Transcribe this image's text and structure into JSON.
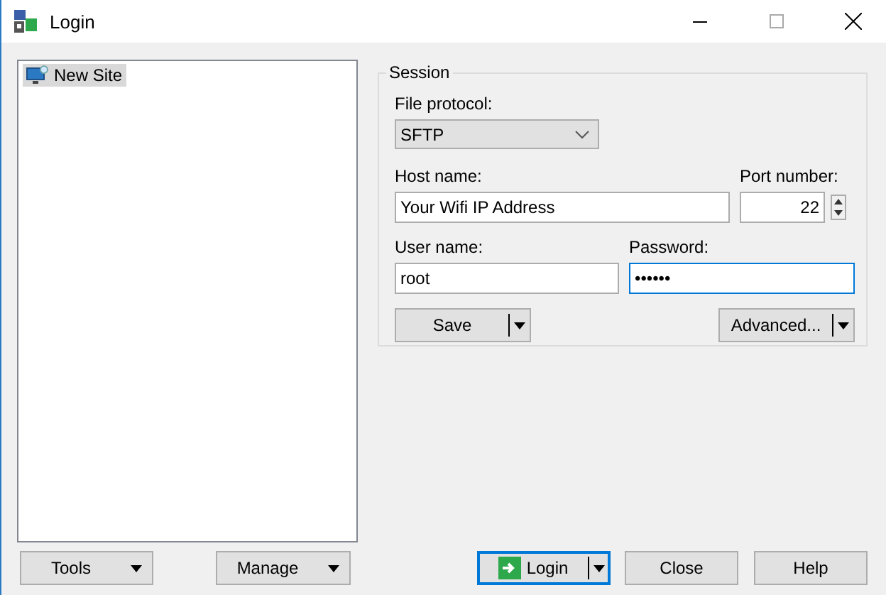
{
  "window": {
    "title": "Login"
  },
  "sites": [
    {
      "label": "New Site",
      "selected": true
    }
  ],
  "session": {
    "title": "Session",
    "file_protocol": {
      "label": "File protocol:",
      "value": "SFTP"
    },
    "host": {
      "label": "Host name:",
      "value": "Your Wifi IP Address"
    },
    "port": {
      "label": "Port number:",
      "value": "22"
    },
    "user": {
      "label": "User name:",
      "value": "root",
      "focused": false
    },
    "password": {
      "label": "Password:",
      "value": "••••••",
      "focused": true
    },
    "save_button": "Save",
    "advanced_button": "Advanced..."
  },
  "footer": [
    {
      "label": "Tools",
      "kind": "split",
      "default": false
    },
    {
      "label": "Manage",
      "kind": "split",
      "default": false
    },
    {
      "label": "Login",
      "kind": "login",
      "default": true
    },
    {
      "label": "Close",
      "kind": "plain",
      "default": false
    },
    {
      "label": "Help",
      "kind": "plain",
      "default": false
    }
  ]
}
